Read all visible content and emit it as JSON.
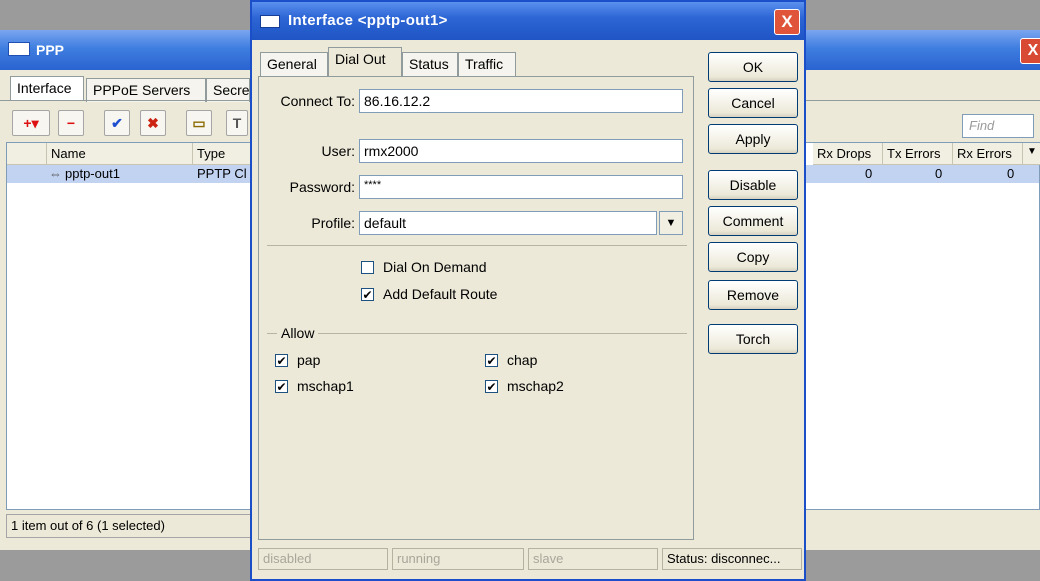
{
  "ppp_window": {
    "title": "PPP",
    "close": "X",
    "tabs": [
      "Interface",
      "PPPoE Servers",
      "Secre"
    ],
    "toolbar": {
      "add": "+▾",
      "remove": "−",
      "enable": "✔",
      "disable": "✖",
      "comment": "▭",
      "filter": "T"
    },
    "find_placeholder": "Find",
    "columns": [
      "Name",
      "Type",
      "Rx Drops",
      "Tx Errors",
      "Rx Errors"
    ],
    "rows": [
      {
        "name": "pptp-out1",
        "type": "PPTP Cl",
        "rx_drops": "0",
        "tx_errors": "0",
        "rx_errors": "0"
      }
    ],
    "status": "1 item out of 6 (1 selected)"
  },
  "dialog": {
    "title": "Interface <pptp-out1>",
    "close": "X",
    "tabs": [
      "General",
      "Dial Out",
      "Status",
      "Traffic"
    ],
    "active_tab": "Dial Out",
    "fields": {
      "connect_to_label": "Connect To:",
      "connect_to_value": "86.16.12.2",
      "user_label": "User:",
      "user_value": "rmx2000",
      "password_label": "Password:",
      "password_value": "****",
      "profile_label": "Profile:",
      "profile_value": "default"
    },
    "dial_on_demand": {
      "label": "Dial On Demand",
      "checked": false
    },
    "add_default_route": {
      "label": "Add Default Route",
      "checked": true
    },
    "allow_label": "Allow",
    "allow": [
      {
        "label": "pap",
        "checked": true
      },
      {
        "label": "chap",
        "checked": true
      },
      {
        "label": "mschap1",
        "checked": true
      },
      {
        "label": "mschap2",
        "checked": true
      }
    ],
    "buttons": [
      "OK",
      "Cancel",
      "Apply",
      "Disable",
      "Comment",
      "Copy",
      "Remove",
      "Torch"
    ],
    "status_bar": [
      "disabled",
      "running",
      "slave",
      "Status: disconnec..."
    ]
  },
  "colors": {
    "titlebar": "#2e66d6",
    "selected_row": "#c2d3f2",
    "close_button": "#e0543a"
  },
  "icons": {
    "dialog": "window-icon",
    "ppp": "window-icon",
    "dropdown": "dropdown-arrow-icon",
    "close": "close-icon"
  }
}
